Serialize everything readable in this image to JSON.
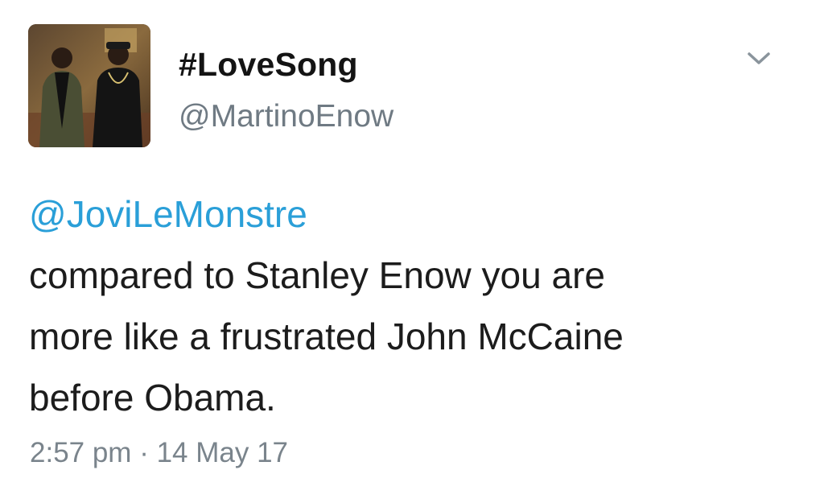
{
  "tweet": {
    "display_name": "#LoveSong",
    "handle": "@MartinoEnow",
    "mention": "@JoviLeMonstre",
    "body_lines": [
      " compared to Stanley Enow you are",
      "more like a frustrated John McCaine",
      "before Obama."
    ],
    "timestamp": "2:57 pm · 14 May 17"
  },
  "icons": {
    "avatar": "profile-photo",
    "menu": "chevron-down-icon"
  },
  "colors": {
    "link": "#2a9fd8",
    "text": "#1c1c1c",
    "muted": "#7a848c"
  }
}
